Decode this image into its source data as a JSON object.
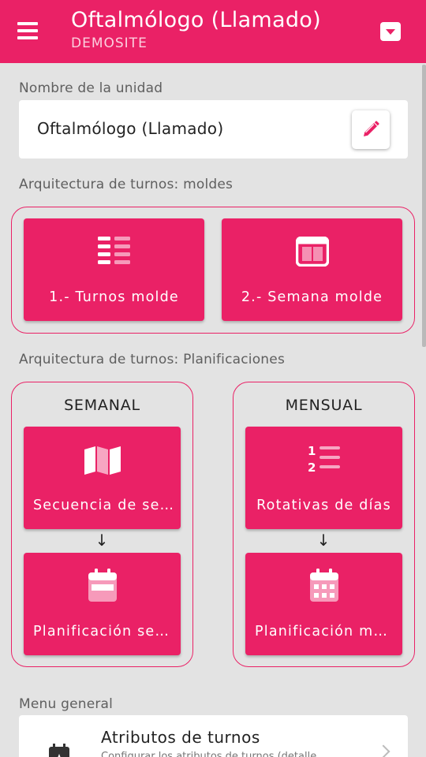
{
  "appbar": {
    "title": "Oftalmólogo (Llamado)",
    "subtitle": "DEMOSITE"
  },
  "unit_name": {
    "label": "Nombre de la unidad",
    "value": "Oftalmólogo (Llamado)"
  },
  "molds": {
    "label": "Arquitectura de turnos: moldes",
    "tiles": [
      {
        "label": "1.- Turnos molde",
        "icon": "list-icon"
      },
      {
        "label": "2.- Semana molde",
        "icon": "window-columns-icon"
      }
    ]
  },
  "plans": {
    "label": "Arquitectura de turnos: Planificaciones",
    "weekly": {
      "title": "SEMANAL",
      "tiles": [
        {
          "label": "Secuencia de se…",
          "icon": "map-icon"
        },
        {
          "label": "Planificación se…",
          "icon": "calendar-week-icon"
        }
      ],
      "arrow": "↓"
    },
    "monthly": {
      "title": "MENSUAL",
      "tiles": [
        {
          "label": "Rotativas de días",
          "icon": "ordered-list-icon"
        },
        {
          "label": "Planificación m…",
          "icon": "calendar-month-icon"
        }
      ],
      "arrow": "↓"
    }
  },
  "general_menu": {
    "label": "Menu general",
    "items": [
      {
        "title": "Atributos de turnos",
        "description": "Configurar los atributos de turnos (detalle",
        "icon": "calendar-star-icon"
      }
    ]
  },
  "colors": {
    "accent": "#ea2166",
    "background": "#e3e3e3"
  }
}
